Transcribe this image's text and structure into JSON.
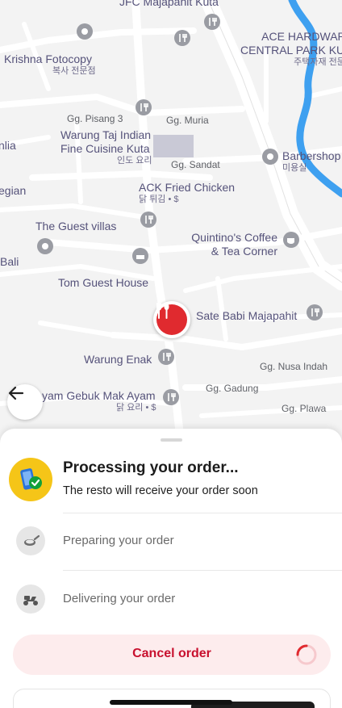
{
  "map": {
    "labels": {
      "jfc": "JFC Majapahit Kuta",
      "ace_line1": "ACE HARDWARE",
      "ace_line2": "CENTRAL PARK KUTA",
      "ace_sub": "주택자재 전문점",
      "krishna": "Krishna Fotocopy",
      "krishna_sub": "복사 전문점",
      "gg_pisang": "Gg. Pisang 3",
      "gg_muria": "Gg. Muria",
      "warung_taj_1": "Warung Taj Indian",
      "warung_taj_2": "Fine Cuisine Kuta",
      "warung_taj_sub": "인도 요리",
      "gg_sandat": "Gg. Sandat",
      "barbershop": "Barbershop",
      "barbershop_sub": "미용실",
      "edge_left1": "nlia",
      "ack": "ACK Fried Chicken",
      "ack_sub": "닭 튀김 • $",
      "edge_left2": "egian",
      "guest_villas": "The Guest villas",
      "quintino_1": "Quintino's Coffee",
      "quintino_2": "& Tea Corner",
      "edge_left3": "Bali",
      "tom_guest": "Tom Guest House",
      "sate_babi": "Sate Babi Majapahit",
      "warung_enak": "Warung Enak",
      "gg_nusa": "Gg. Nusa Indah",
      "ayam_gebuk": "yam Gebuk Mak Ayam",
      "ayam_sub": "닭 요리 • $",
      "gg_gadung": "Gg. Gadung",
      "gg_plawa": "Gg. Plawa"
    }
  },
  "order_status": {
    "title": "Processing your order...",
    "subtitle": "The resto will receive your order soon"
  },
  "steps": [
    {
      "label": "Preparing your order",
      "icon": "cooking-pan-icon"
    },
    {
      "label": "Delivering your order",
      "icon": "scooter-icon"
    }
  ],
  "actions": {
    "cancel_label": "Cancel order"
  },
  "colors": {
    "accent_red": "#c8102e",
    "marker_red": "#e02a2f",
    "status_yellow": "#f5c518",
    "status_green": "#12a03a",
    "river_blue": "#3ea0f0"
  }
}
